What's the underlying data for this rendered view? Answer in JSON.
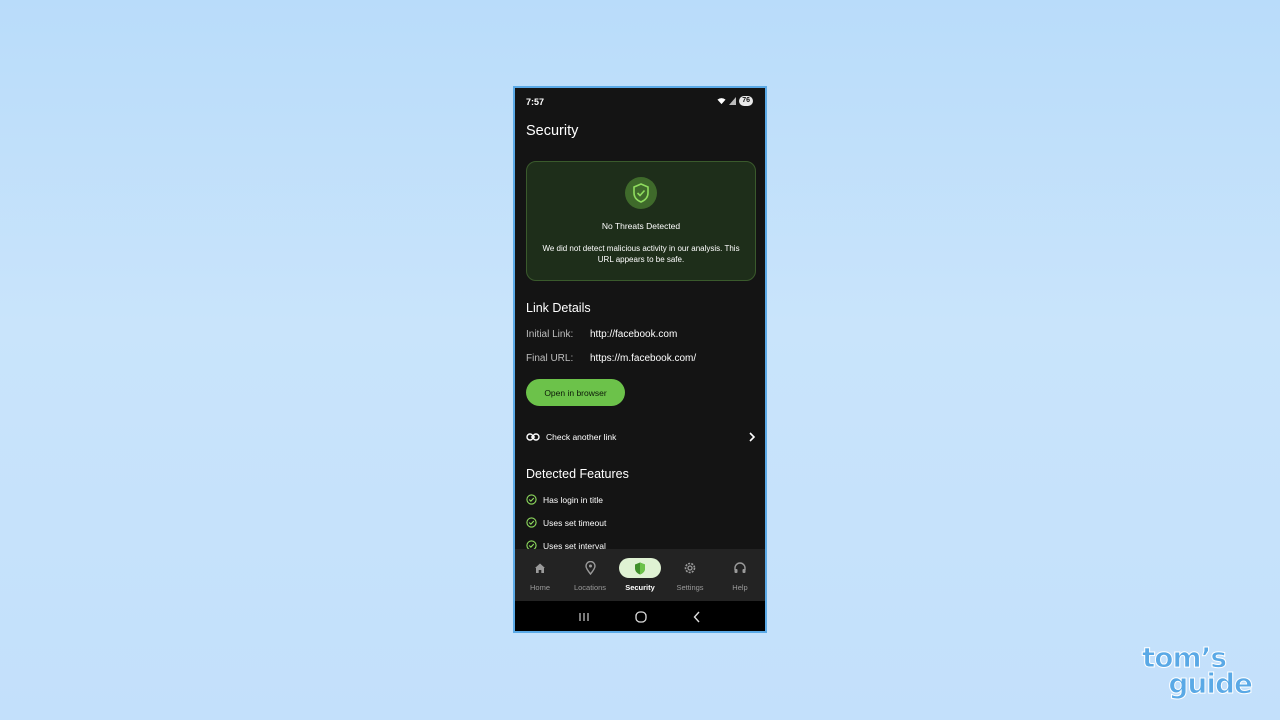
{
  "status_bar": {
    "time": "7:57",
    "battery": "76"
  },
  "page": {
    "title": "Security"
  },
  "result": {
    "title": "No Threats Detected",
    "description": "We did not detect malicious activity in our analysis. This URL appears to be safe."
  },
  "link_details": {
    "heading": "Link Details",
    "initial_label": "Initial Link:",
    "initial_value": "http://facebook.com",
    "final_label": "Final URL:",
    "final_value": "https://m.facebook.com/"
  },
  "open_button": "Open in browser",
  "check_another": "Check another link",
  "detected_features": {
    "heading": "Detected Features",
    "items": [
      "Has login in title",
      "Uses set timeout",
      "Uses set interval"
    ]
  },
  "nav": {
    "items": [
      {
        "label": "Home",
        "icon": "home-icon"
      },
      {
        "label": "Locations",
        "icon": "location-pin-icon"
      },
      {
        "label": "Security",
        "icon": "shield-icon",
        "active": true
      },
      {
        "label": "Settings",
        "icon": "gear-icon"
      },
      {
        "label": "Help",
        "icon": "headset-icon"
      }
    ]
  },
  "colors": {
    "accent": "#6cc24a",
    "card_bg": "#1e2e1a",
    "background": "#141414"
  },
  "watermark": {
    "line1": "tom’s",
    "line2": "guide"
  }
}
